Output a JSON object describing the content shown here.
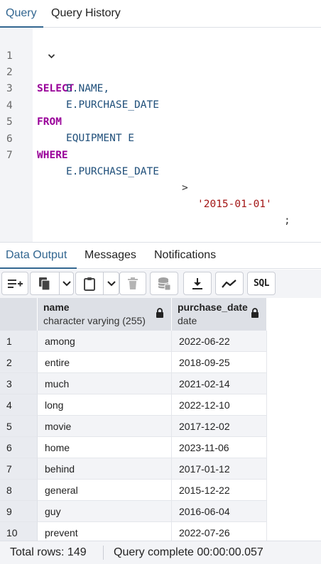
{
  "query_tabs": [
    {
      "label": "Query"
    },
    {
      "label": "Query History"
    }
  ],
  "editor": {
    "lines": [
      {
        "n": "1",
        "fold": "⌄"
      },
      {
        "n": "2"
      },
      {
        "n": "3"
      },
      {
        "n": "4"
      },
      {
        "n": "5"
      },
      {
        "n": "6"
      },
      {
        "n": "7"
      }
    ],
    "tokens": {
      "select_kw": "SELECT",
      "col_name": "E.NAME,",
      "col_date": "E.PURCHASE_DATE",
      "from_kw": "FROM",
      "table": "EQUIPMENT E",
      "where_kw": "WHERE",
      "where_col": "E.PURCHASE_DATE",
      "where_op": ">",
      "where_val": "'2015-01-01'",
      "terminator": ";"
    }
  },
  "output_tabs": [
    {
      "label": "Data Output"
    },
    {
      "label": "Messages"
    },
    {
      "label": "Notifications"
    }
  ],
  "toolbar": {
    "icons": [
      "add-row-icon",
      "copy-icon",
      "chevron-down-icon",
      "paste-icon",
      "chevron-down-icon",
      "delete-icon",
      "save-data-icon",
      "download-icon",
      "graph-icon"
    ],
    "sql_label": "SQL"
  },
  "grid": {
    "columns": [
      {
        "name": "name",
        "type": "character varying (255)"
      },
      {
        "name": "purchase_date",
        "type": "date"
      }
    ],
    "rows": [
      {
        "n": "1",
        "name": "among",
        "purchase_date": "2022-06-22"
      },
      {
        "n": "2",
        "name": "entire",
        "purchase_date": "2018-09-25"
      },
      {
        "n": "3",
        "name": "much",
        "purchase_date": "2021-02-14"
      },
      {
        "n": "4",
        "name": "long",
        "purchase_date": "2022-12-10"
      },
      {
        "n": "5",
        "name": "movie",
        "purchase_date": "2017-12-02"
      },
      {
        "n": "6",
        "name": "home",
        "purchase_date": "2023-11-06"
      },
      {
        "n": "7",
        "name": "behind",
        "purchase_date": "2017-01-12"
      },
      {
        "n": "8",
        "name": "general",
        "purchase_date": "2015-12-22"
      },
      {
        "n": "9",
        "name": "guy",
        "purchase_date": "2016-06-04"
      },
      {
        "n": "10",
        "name": "prevent",
        "purchase_date": "2022-07-26"
      }
    ]
  },
  "status": {
    "total_rows": "Total rows: 149",
    "query_complete": "Query complete 00:00:00.057"
  },
  "colors": {
    "accent": "#326690",
    "keyword": "#990099",
    "identifier": "#1f4f7a",
    "string": "#a31515"
  }
}
